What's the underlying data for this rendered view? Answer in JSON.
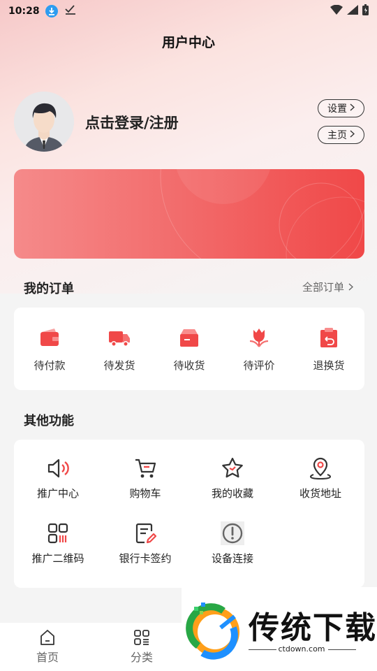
{
  "status_bar": {
    "time": "10:28"
  },
  "header": {
    "title": "用户中心"
  },
  "profile": {
    "login_text": "点击登录/注册",
    "settings_label": "设置",
    "home_label": "主页"
  },
  "orders": {
    "title": "我的订单",
    "all_label": "全部订单",
    "items": [
      {
        "label": "待付款",
        "icon": "wallet-icon"
      },
      {
        "label": "待发货",
        "icon": "truck-icon"
      },
      {
        "label": "待收货",
        "icon": "package-icon"
      },
      {
        "label": "待评价",
        "icon": "flower-icon"
      },
      {
        "label": "退换货",
        "icon": "return-clipboard-icon"
      }
    ]
  },
  "other": {
    "title": "其他功能",
    "items": [
      {
        "label": "推广中心",
        "icon": "speaker-icon"
      },
      {
        "label": "购物车",
        "icon": "cart-icon"
      },
      {
        "label": "我的收藏",
        "icon": "star-icon"
      },
      {
        "label": "收货地址",
        "icon": "location-icon"
      },
      {
        "label": "推广二维码",
        "icon": "qrcode-icon"
      },
      {
        "label": "银行卡签约",
        "icon": "edit-document-icon"
      },
      {
        "label": "设备连接",
        "icon": "alert-circle-icon"
      }
    ]
  },
  "nav": {
    "items": [
      {
        "label": "首页",
        "icon": "home-icon"
      },
      {
        "label": "分类",
        "icon": "category-icon"
      }
    ]
  },
  "watermark": {
    "text": "传统下载",
    "url": "ctdown.com"
  },
  "colors": {
    "accent": "#f04848",
    "text": "#222222"
  }
}
